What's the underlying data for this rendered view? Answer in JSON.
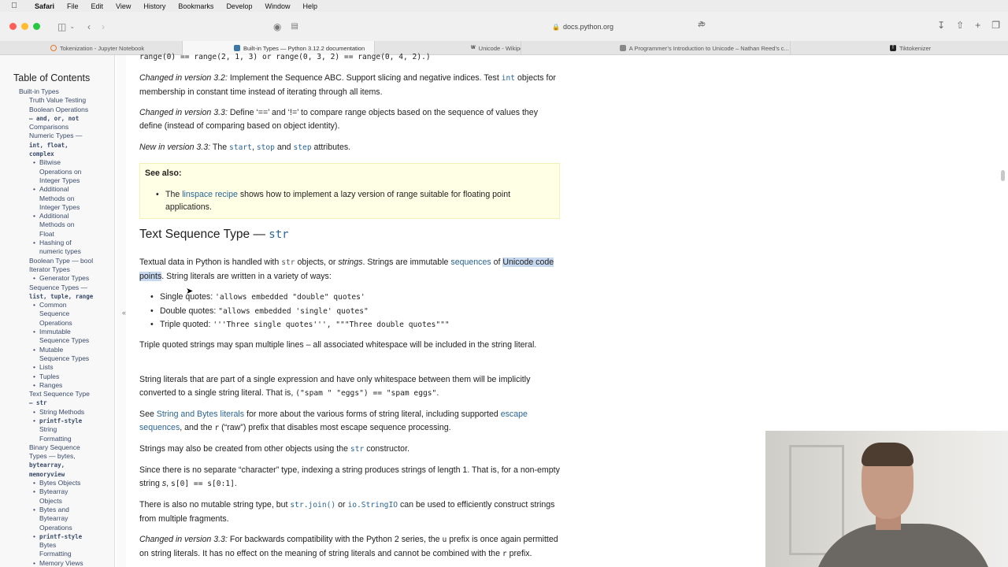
{
  "menubar": {
    "app": "Safari",
    "items": [
      "File",
      "Edit",
      "View",
      "History",
      "Bookmarks",
      "Develop",
      "Window",
      "Help"
    ]
  },
  "toolbar": {
    "address": "docs.python.org"
  },
  "tabs": [
    {
      "label": "Tokenization - Jupyter Notebook",
      "icon": "jupyter-icon"
    },
    {
      "label": "Built-in Types — Python 3.12.2 documentation",
      "icon": "python-icon"
    },
    {
      "label": "Unicode - Wikipedia",
      "icon": "wikipedia-icon"
    },
    {
      "label": "A Programmer’s Introduction to Unicode – Nathan Reed’s c...",
      "icon": "page-icon"
    },
    {
      "label": "Tiktokenizer",
      "icon": "tiktokenizer-icon"
    }
  ],
  "sidebar": {
    "title": "Table of Contents",
    "items": [
      {
        "level": 0,
        "text": "Built-in Types"
      },
      {
        "level": 1,
        "text": "Truth Value Testing"
      },
      {
        "level": 1,
        "text": "Boolean Operations"
      },
      {
        "level": 1,
        "text": "— and, or, not",
        "mono": true
      },
      {
        "level": 1,
        "text": "Comparisons"
      },
      {
        "level": 1,
        "text": "Numeric Types —"
      },
      {
        "level": 1,
        "text": "int, float,",
        "mono": true
      },
      {
        "level": 1,
        "text": "complex",
        "mono": true
      },
      {
        "level": 2,
        "text": "Bitwise"
      },
      {
        "level": 3,
        "text": "Operations on"
      },
      {
        "level": 3,
        "text": "Integer Types"
      },
      {
        "level": 2,
        "text": "Additional"
      },
      {
        "level": 3,
        "text": "Methods on"
      },
      {
        "level": 3,
        "text": "Integer Types"
      },
      {
        "level": 2,
        "text": "Additional"
      },
      {
        "level": 3,
        "text": "Methods on"
      },
      {
        "level": 3,
        "text": "Float"
      },
      {
        "level": 2,
        "text": "Hashing of"
      },
      {
        "level": 3,
        "text": "numeric types"
      },
      {
        "level": 1,
        "text": "Boolean Type — bool"
      },
      {
        "level": 1,
        "text": "Iterator Types"
      },
      {
        "level": 2,
        "text": "Generator Types"
      },
      {
        "level": 1,
        "text": "Sequence Types —"
      },
      {
        "level": 1,
        "text": "list, tuple, range",
        "mono": true
      },
      {
        "level": 2,
        "text": "Common"
      },
      {
        "level": 3,
        "text": "Sequence"
      },
      {
        "level": 3,
        "text": "Operations"
      },
      {
        "level": 2,
        "text": "Immutable"
      },
      {
        "level": 3,
        "text": "Sequence Types"
      },
      {
        "level": 2,
        "text": "Mutable"
      },
      {
        "level": 3,
        "text": "Sequence Types"
      },
      {
        "level": 2,
        "text": "Lists"
      },
      {
        "level": 2,
        "text": "Tuples"
      },
      {
        "level": 2,
        "text": "Ranges"
      },
      {
        "level": 1,
        "text": "Text Sequence Type"
      },
      {
        "level": 1,
        "text": "— str",
        "mono": true
      },
      {
        "level": 2,
        "text": "String Methods"
      },
      {
        "level": 2,
        "text": "printf-style",
        "mono": true
      },
      {
        "level": 3,
        "text": "String"
      },
      {
        "level": 3,
        "text": "Formatting"
      },
      {
        "level": 1,
        "text": "Binary Sequence"
      },
      {
        "level": 1,
        "text": "Types — bytes,"
      },
      {
        "level": 1,
        "text": "bytearray,",
        "mono": true
      },
      {
        "level": 1,
        "text": "memoryview",
        "mono": true
      },
      {
        "level": 2,
        "text": "Bytes Objects"
      },
      {
        "level": 2,
        "text": "Bytearray"
      },
      {
        "level": 3,
        "text": "Objects"
      },
      {
        "level": 2,
        "text": "Bytes and"
      },
      {
        "level": 3,
        "text": "Bytearray"
      },
      {
        "level": 3,
        "text": "Operations"
      },
      {
        "level": 2,
        "text": "printf-style",
        "mono": true
      },
      {
        "level": 3,
        "text": "Bytes"
      },
      {
        "level": 3,
        "text": "Formatting"
      },
      {
        "level": 2,
        "text": "Memory Views"
      }
    ]
  },
  "content": {
    "top_code": "range(0) == range(2, 1, 3) or range(0, 3, 2) == range(0, 4, 2).)",
    "changed_32_label": "Changed in version 3.2:",
    "changed_32_text_a": " Implement the Sequence ABC. Support slicing and negative indices. Test ",
    "changed_32_code": "int",
    "changed_32_text_b": " objects for membership in constant time instead of iterating through all items.",
    "changed_33_label": "Changed in version 3.3:",
    "changed_33_text": " Define ‘==’ and ‘!=’ to compare range objects based on the sequence of values they define (instead of comparing based on object identity).",
    "new_33_label": "New in version 3.3:",
    "new_33_text_a": " The ",
    "new_33_start": "start",
    "new_33_sep1": ", ",
    "new_33_stop": "stop",
    "new_33_and": " and ",
    "new_33_step": "step",
    "new_33_text_b": " attributes.",
    "seealso_title": "See also:",
    "seealso_a": "The ",
    "seealso_link": "linspace recipe",
    "seealso_b": " shows how to implement a lazy version of range suitable for floating point applications.",
    "heading_text": "Text Sequence Type — ",
    "heading_code": "str",
    "p1_a": "Textual data in Python is handled with ",
    "p1_code": "str",
    "p1_b": " objects, or ",
    "p1_em": "strings",
    "p1_c": ". Strings are immutable ",
    "p1_link": "sequences",
    "p1_d": " of ",
    "p1_sel": "Unicode code points",
    "p1_e": ". String literals are written in a variety of ways:",
    "bullets": [
      {
        "label": "Single quotes: ",
        "code": "'allows embedded \"double\" quotes'"
      },
      {
        "label": "Double quotes: ",
        "code": "\"allows embedded 'single' quotes\""
      },
      {
        "label": "Triple quoted: ",
        "code": "'''Three single quotes''', \"\"\"Three double quotes\"\"\""
      }
    ],
    "p2": "Triple quoted strings may span multiple lines – all associated whitespace will be included in the string literal.",
    "p3_a": "String literals that are part of a single expression and have only whitespace between them will be implicitly converted to a single string literal. That is, ",
    "p3_code": "(\"spam \" \"eggs\") == \"spam eggs\"",
    "p3_b": ".",
    "p4_a": "See ",
    "p4_link1": "String and Bytes literals",
    "p4_b": " for more about the various forms of string literal, including supported ",
    "p4_link2": "escape sequences",
    "p4_c": ", and the ",
    "p4_code": "r",
    "p4_d": " (“raw”) prefix that disables most escape sequence processing.",
    "p5_a": "Strings may also be created from other objects using the ",
    "p5_code": "str",
    "p5_b": " constructor.",
    "p6_a": "Since there is no separate “character” type, indexing a string produces strings of length 1. That is, for a non-empty string ",
    "p6_em": "s",
    "p6_b": ", ",
    "p6_code": "s[0] == s[0:1]",
    "p6_c": ".",
    "p7_a": "There is also no mutable string type, but ",
    "p7_code1": "str.join()",
    "p7_b": " or ",
    "p7_code2": "io.StringIO",
    "p7_c": " can be used to efficiently construct strings from multiple fragments.",
    "p8_label": "Changed in version 3.3:",
    "p8_a": " For backwards compatibility with the Python 2 series, the ",
    "p8_code": "u",
    "p8_b": " prefix is once again permitted on string literals. It has no effect on the meaning of string literals and cannot be combined with the ",
    "p8_code2": "r",
    "p8_c": " prefix."
  },
  "colors": {
    "link": "#2a6496",
    "seealso_bg": "#ffffe5",
    "selection": "#c7d9f0"
  }
}
